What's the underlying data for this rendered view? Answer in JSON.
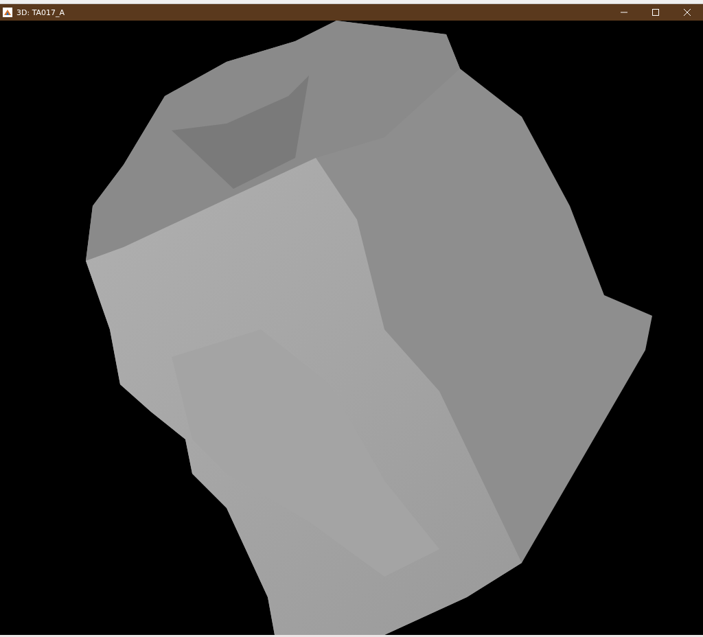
{
  "window": {
    "title": "3D: TA017_A"
  }
}
